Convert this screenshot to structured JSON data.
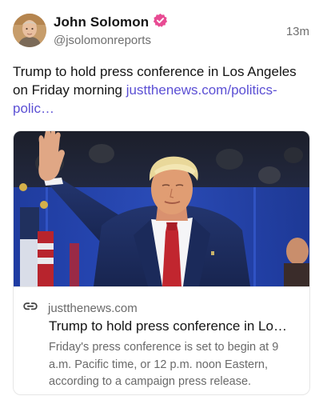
{
  "post": {
    "author_name": "John Solomon",
    "author_handle": "@jsolomonreports",
    "time": "13m",
    "text": "Trump to hold press conference in Los Angeles on Friday morning ",
    "link_text": "justthenews.com/politics-polic…"
  },
  "link_card": {
    "domain": "justthenews.com",
    "title": "Trump to hold press conference in Lo…",
    "description": "Friday's press conference is set to begin at 9 a.m. Pacific time, or 12 p.m. noon Eastern, according to a campaign press release."
  },
  "colors": {
    "accent": "#5b4fd4",
    "verified_badge": "#e84b93",
    "muted_text": "#6f6f6f"
  },
  "icons": {
    "verified": "verified-icon",
    "link": "link-icon"
  }
}
